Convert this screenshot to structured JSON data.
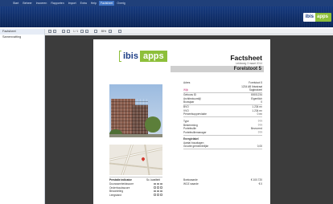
{
  "menubar": {
    "items": [
      "Start",
      "Beheer",
      "Invoeren",
      "Rapporten",
      "Import",
      "Extra",
      "Help",
      "Factsheet",
      "Overig"
    ],
    "active_index": 7
  },
  "brand": {
    "logo_a": "ibis",
    "logo_b": "apps"
  },
  "sidebar": {
    "items": [
      "Factsheet",
      "Samenvatting"
    ],
    "selected_index": 0
  },
  "toolbar": {
    "page_indicator": "1 / 1",
    "zoom": "85%",
    "icons": [
      "print-icon",
      "save-icon",
      "first-page-icon",
      "prev-page-icon",
      "next-page-icon",
      "last-page-icon",
      "zoom-in-icon",
      "zoom-out-icon",
      "search-icon"
    ]
  },
  "document": {
    "logo_a": "ibis",
    "logo_b": "apps",
    "title": "Factsheet",
    "subtitle": "Leidsweg 3 maart 2014",
    "object_name": "Forelstoot 5",
    "address_block": [
      {
        "k": "Adres",
        "v": "Forelstoot 5"
      },
      {
        "k": "",
        "v": "1234 AB Ibisstraat"
      },
      {
        "k": "Wijk",
        "v": "Sagbrakeel"
      }
    ],
    "info_block": [
      {
        "k": "Gebouw ID",
        "v": "00001234"
      },
      {
        "k": "Architectuurstijl",
        "v": "Eigentlich"
      },
      {
        "k": "Bouwjaar",
        "v": "0"
      }
    ],
    "area_block": [
      {
        "k": "BVO",
        "v": "1.234 m²"
      },
      {
        "k": "VVO",
        "v": "1.234 m²"
      },
      {
        "k": "Perceelsoppervlakte",
        "v": "0 m²"
      }
    ],
    "type_block": [
      {
        "k": "Type",
        "v": "???"
      },
      {
        "k": "Bestemming",
        "v": "???"
      },
      {
        "k": "Portefeuille",
        "v": "Bevoorrrd"
      },
      {
        "k": "Portefeuillemanager",
        "v": "???"
      }
    ],
    "energy_block": [
      {
        "k": "Energielabel",
        "v": ""
      },
      {
        "k": "Aantal bouwlagen",
        "v": ""
      },
      {
        "k": "Grootte gemeentelijke",
        "v": "0,00"
      }
    ],
    "finance_block": [
      {
        "k": "Boekwaarde",
        "v": "€ 100.720"
      },
      {
        "k": "WOZ waarde",
        "v": "€ 0"
      }
    ],
    "wz": {
      "title": "Prestatie indicator",
      "header": "Sc. kwaliteit",
      "rows": [
        "Duurzaamheidsscore",
        "Onderhoudsscore",
        "Beoordeling",
        "Leegstand"
      ]
    }
  },
  "colors": {
    "menubar": "#20407a",
    "banner": "#0e2d6b",
    "brand_green": "#8dbf3a",
    "brand_blue": "#1d3e86",
    "viewer_bg": "#3c3c3c",
    "accent_pink": "#c03a78"
  }
}
